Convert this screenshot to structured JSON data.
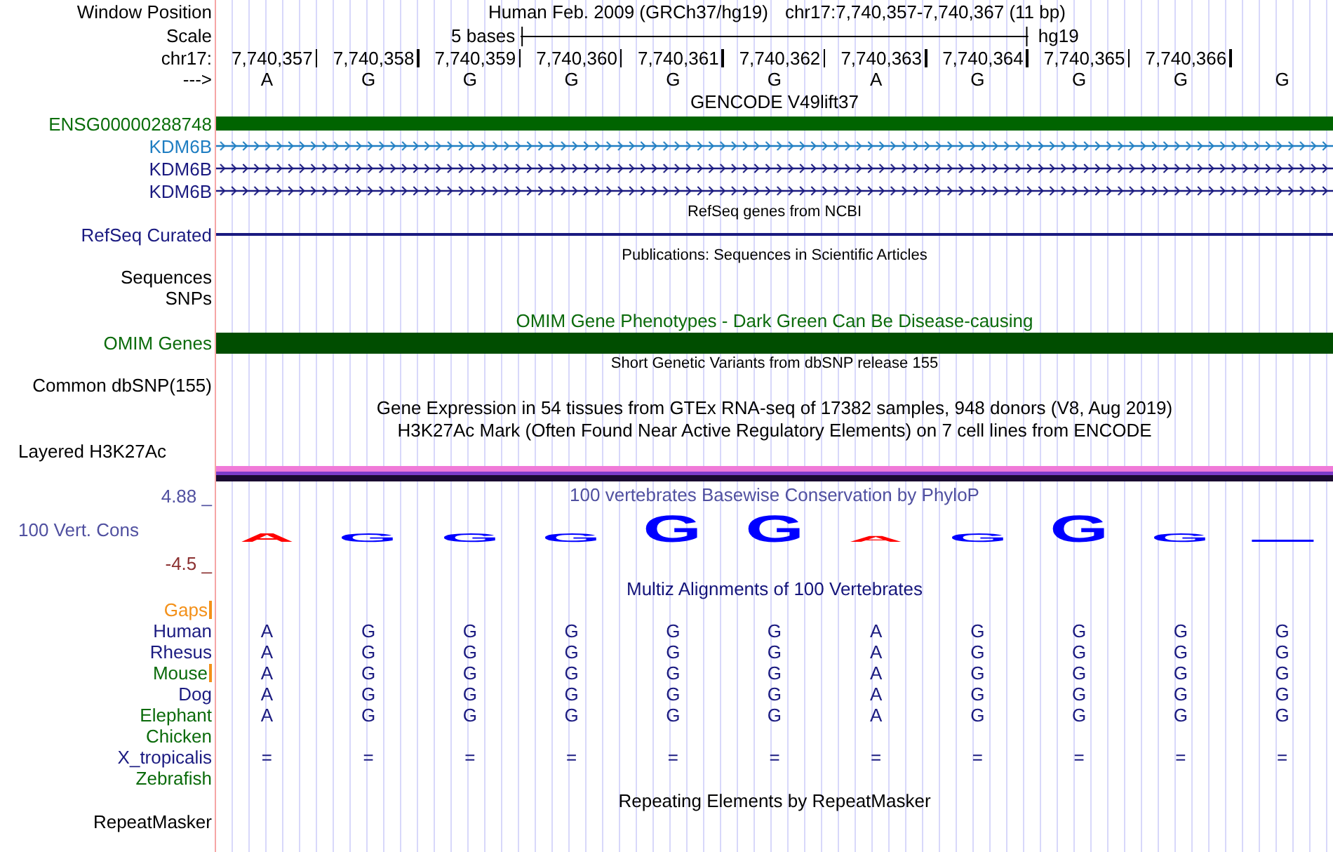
{
  "rows": [
    {
      "kind": "header",
      "label": "Window Position",
      "color": "#000000",
      "texts": [
        "Human Feb. 2009 (GRCh37/hg19)",
        "chr17:7,740,357-7,740,367 (11 bp)"
      ]
    },
    {
      "kind": "scale",
      "label": "Scale",
      "color": "#000000",
      "scale_text": "5 bases",
      "assembly": "hg19"
    },
    {
      "kind": "ruler",
      "label": "chr17:",
      "color": "#000000",
      "positions": [
        "7,740,357",
        "7,740,358",
        "7,740,359",
        "7,740,360",
        "7,740,361",
        "7,740,362",
        "7,740,363",
        "7,740,364",
        "7,740,365",
        "7,740,366"
      ]
    },
    {
      "kind": "bases",
      "label": "--->",
      "color": "#000000",
      "bases": [
        "A",
        "G",
        "G",
        "G",
        "G",
        "G",
        "A",
        "G",
        "G",
        "G",
        "G"
      ]
    },
    {
      "kind": "title",
      "text": "GENCODE V49lift37",
      "color": "#000000"
    },
    {
      "kind": "gene_bar",
      "label": "ENSG00000288748",
      "color": "#0b6e0b"
    },
    {
      "kind": "strand",
      "label": "KDM6B",
      "color": "#1f7ec2"
    },
    {
      "kind": "strand",
      "label": "KDM6B",
      "color": "#1a1a80"
    },
    {
      "kind": "strand",
      "label": "KDM6B",
      "color": "#1a1a80"
    },
    {
      "kind": "small_title",
      "text": "RefSeq genes from NCBI",
      "color": "#000000"
    },
    {
      "kind": "line",
      "label": "RefSeq Curated",
      "color": "#1a1a80"
    },
    {
      "kind": "small_title",
      "text": "Publications: Sequences in Scientific Articles",
      "color": "#000000"
    },
    {
      "kind": "label",
      "label": "Sequences",
      "color": "#000000"
    },
    {
      "kind": "label",
      "label": "SNPs",
      "color": "#000000"
    },
    {
      "kind": "title",
      "text": "OMIM Gene Phenotypes - Dark Green Can Be Disease-causing",
      "color": "#0c6b0c"
    },
    {
      "kind": "omim_bar",
      "label": "OMIM Genes",
      "color": "#0b6b0b"
    },
    {
      "kind": "small_title",
      "text": "Short Genetic Variants from dbSNP release 155",
      "color": "#000000"
    },
    {
      "kind": "label",
      "label": "Common dbSNP(155)",
      "color": "#000000"
    },
    {
      "kind": "title",
      "text": "Gene Expression in 54 tissues from GTEx RNA-seq of 17382 samples, 948 donors (V8, Aug 2019)",
      "color": "#000000"
    },
    {
      "kind": "title",
      "text": "H3K27Ac Mark (Often Found Near Active Regulatory Elements) on 7 cell lines from ENCODE",
      "color": "#000000"
    },
    {
      "kind": "layered",
      "label": "Layered H3K27Ac",
      "color": "#000000"
    },
    {
      "kind": "conservation",
      "label": "100 Vert. Cons",
      "color": "#5050a0",
      "title": "100 vertebrates Basewise Conservation by PhyloP",
      "scale_top": {
        "text": "4.88 _",
        "color": "#5050a0"
      },
      "scale_bottom": {
        "text": "-4.5 _",
        "color": "#8b3030"
      },
      "logo": [
        {
          "base": "A",
          "kind": "short",
          "color": "#ff0000"
        },
        {
          "base": "G",
          "kind": "short",
          "color": "#0000ff"
        },
        {
          "base": "G",
          "kind": "short",
          "color": "#0000ff"
        },
        {
          "base": "G",
          "kind": "short",
          "color": "#0000ff"
        },
        {
          "base": "G",
          "kind": "tall",
          "color": "#0000ff"
        },
        {
          "base": "G",
          "kind": "tall",
          "color": "#0000ff"
        },
        {
          "base": "A",
          "kind": "low",
          "color": "#ff0000"
        },
        {
          "base": "G",
          "kind": "short",
          "color": "#0000ff"
        },
        {
          "base": "G",
          "kind": "tall",
          "color": "#0000ff"
        },
        {
          "base": "G",
          "kind": "short",
          "color": "#0000ff"
        },
        {
          "kind": "flat",
          "color": "#0000ff"
        }
      ]
    },
    {
      "kind": "title",
      "text": "Multiz Alignments of 100 Vertebrates",
      "color": "#14147a"
    },
    {
      "kind": "alignment",
      "label": "Gaps",
      "color": "#f39019",
      "gap_mark": true
    },
    {
      "kind": "alignment",
      "label": "Human",
      "color": "#1a1a80",
      "gap_mark": false,
      "bases": [
        "A",
        "G",
        "G",
        "G",
        "G",
        "G",
        "A",
        "G",
        "G",
        "G",
        "G"
      ]
    },
    {
      "kind": "alignment",
      "label": "Rhesus",
      "color": "#1a1a80",
      "gap_mark": false,
      "bases": [
        "A",
        "G",
        "G",
        "G",
        "G",
        "G",
        "A",
        "G",
        "G",
        "G",
        "G"
      ]
    },
    {
      "kind": "alignment",
      "label": "Mouse",
      "color": "#0b6b0b",
      "gap_mark": true,
      "bases": [
        "A",
        "G",
        "G",
        "G",
        "G",
        "G",
        "A",
        "G",
        "G",
        "G",
        "G"
      ]
    },
    {
      "kind": "alignment",
      "label": "Dog",
      "color": "#1a1a80",
      "gap_mark": false,
      "bases": [
        "A",
        "G",
        "G",
        "G",
        "G",
        "G",
        "A",
        "G",
        "G",
        "G",
        "G"
      ]
    },
    {
      "kind": "alignment",
      "label": "Elephant",
      "color": "#0b6b0b",
      "gap_mark": false,
      "bases": [
        "A",
        "G",
        "G",
        "G",
        "G",
        "G",
        "A",
        "G",
        "G",
        "G",
        "G"
      ]
    },
    {
      "kind": "alignment",
      "label": "Chicken",
      "color": "#0b6b0b",
      "gap_mark": false
    },
    {
      "kind": "alignment",
      "label": "X_tropicalis",
      "color": "#1a1a80",
      "gap_mark": false,
      "bases": [
        "=",
        "=",
        "=",
        "=",
        "=",
        "=",
        "=",
        "=",
        "=",
        "=",
        "="
      ]
    },
    {
      "kind": "alignment",
      "label": "Zebrafish",
      "color": "#0b6b0b",
      "gap_mark": false
    },
    {
      "kind": "title",
      "text": "Repeating Elements by RepeatMasker",
      "color": "#000000"
    },
    {
      "kind": "label",
      "label": "RepeatMasker",
      "color": "#000000"
    }
  ]
}
